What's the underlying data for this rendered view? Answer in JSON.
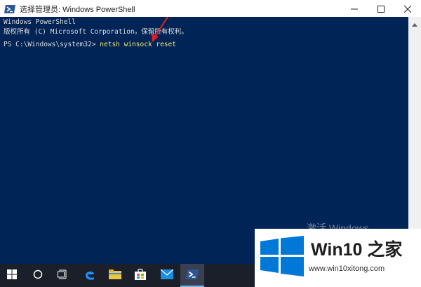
{
  "window": {
    "title": "选择管理员: Windows PowerShell",
    "icon": "powershell-icon",
    "controls": [
      "minimize-icon",
      "maximize-icon",
      "close-icon"
    ]
  },
  "console": {
    "background": "#012456",
    "lines": [
      "Windows PowerShell",
      "版权所有 (C) Microsoft Corporation。保留所有权利。"
    ],
    "prompt": "PS C:\\Windows\\system32> ",
    "command": "netsh winsock reset",
    "command_color": "#f2e96d",
    "annotation": "red-arrow"
  },
  "watermark": {
    "activation": "激活 Windows",
    "logo_text": "Win10 之家",
    "logo_url": "www.win10xitong.com"
  },
  "taskbar": {
    "items": [
      "windows-start-icon",
      "cortana-search-icon",
      "task-view-icon",
      "edge-icon",
      "file-explorer-icon",
      "store-icon",
      "mail-icon",
      "powershell-icon"
    ],
    "active_item": "powershell-icon"
  }
}
